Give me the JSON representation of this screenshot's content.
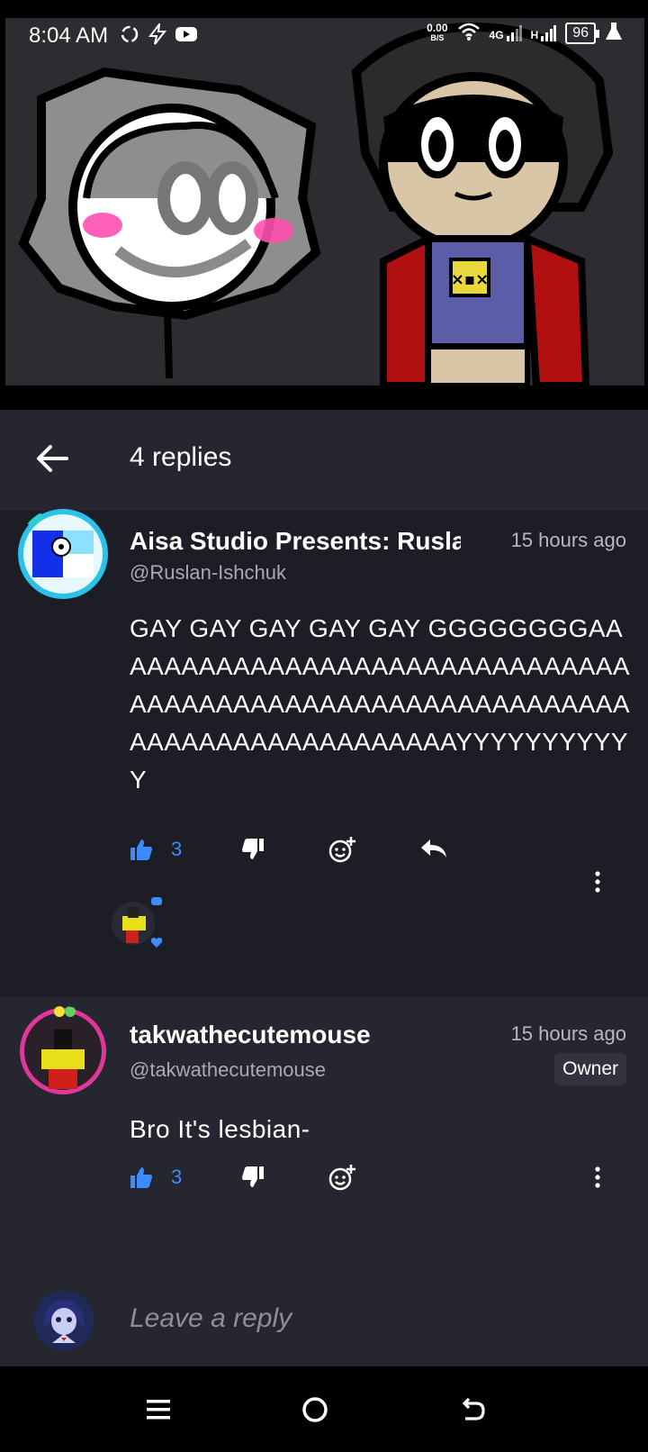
{
  "status_bar": {
    "time": "8:04 AM",
    "net_speed_value": "0.00",
    "net_speed_unit": "B/S",
    "network_4g": "4G",
    "network_h": "H",
    "battery": "96"
  },
  "header": {
    "title": "4 replies"
  },
  "comments": [
    {
      "author": "Aisa Studio Presents: Ruslan-Ishchuk",
      "handle": "@Ruslan-Ishchuk",
      "time": "15 hours ago",
      "text": "GAY GAY GAY GAY GAY GGGGGGGGAAAAAAAAAAAAAAAAAAAAAAAAAAAAAAAAAAAAAAAAAAAAAAAAAAAAAAAAAAAAAAAAAAAAAAAAAAAAAAAYYYYYYYYYYY",
      "likes": "3"
    },
    {
      "author": "takwathecutemouse",
      "handle": "@takwathecutemouse",
      "time": "15 hours ago",
      "badge": "Owner",
      "text": "Bro It's lesbian-",
      "likes": "3"
    }
  ],
  "reply_bar": {
    "placeholder": "Leave a reply"
  },
  "colors": {
    "accent_blue": "#3a8cff",
    "panel": "#262631",
    "background": "#1d1d26"
  }
}
